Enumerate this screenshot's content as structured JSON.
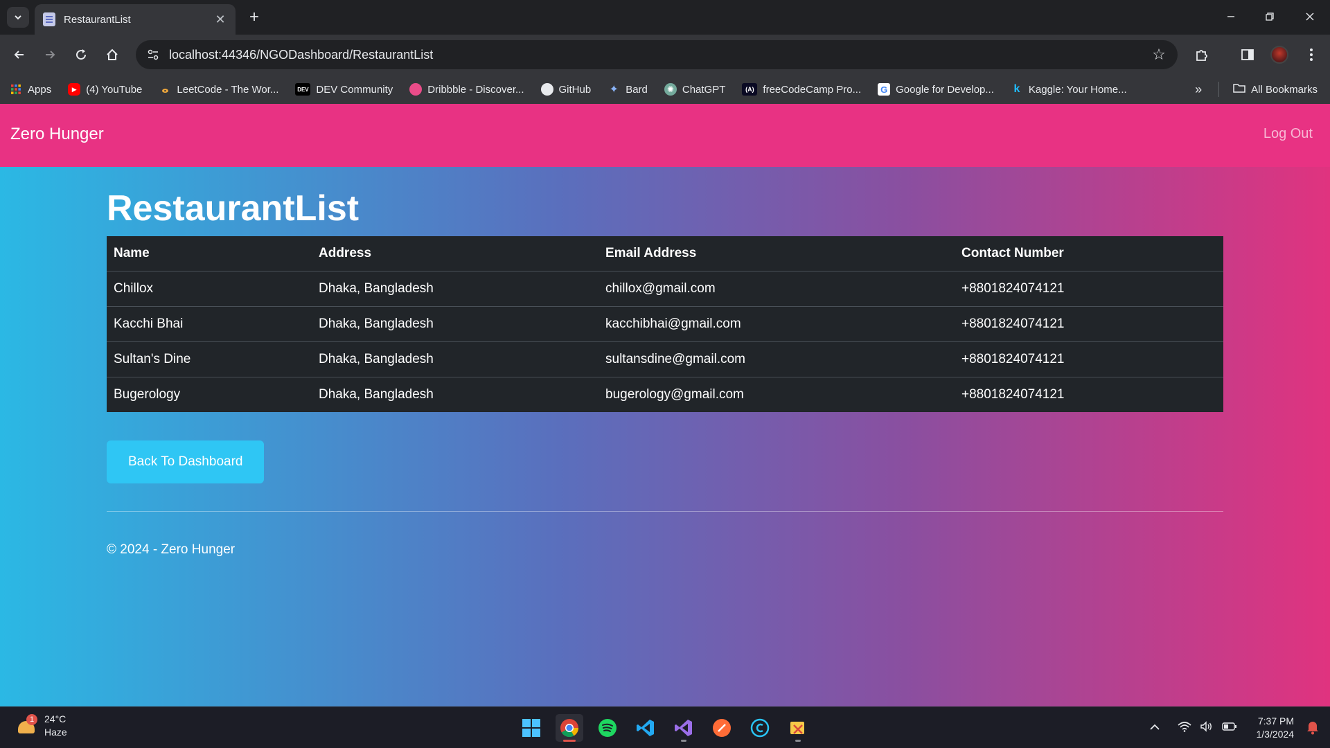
{
  "browser": {
    "tab_title": "RestaurantList",
    "url": "localhost:44346/NGODashboard/RestaurantList",
    "bookmarks": [
      {
        "label": "Apps",
        "icon": "apps-grid-icon"
      },
      {
        "label": "(4) YouTube",
        "icon": "youtube-icon"
      },
      {
        "label": "LeetCode - The Wor...",
        "icon": "leetcode-icon"
      },
      {
        "label": "DEV Community",
        "icon": "dev-icon"
      },
      {
        "label": "Dribbble - Discover...",
        "icon": "dribbble-icon"
      },
      {
        "label": "GitHub",
        "icon": "github-icon"
      },
      {
        "label": "Bard",
        "icon": "bard-icon"
      },
      {
        "label": "ChatGPT",
        "icon": "chatgpt-icon"
      },
      {
        "label": "freeCodeCamp Pro...",
        "icon": "freecodecamp-icon"
      },
      {
        "label": "Google for Develop...",
        "icon": "google-icon"
      },
      {
        "label": "Kaggle: Your Home...",
        "icon": "kaggle-icon"
      }
    ],
    "all_bookmarks": "All Bookmarks"
  },
  "navbar": {
    "brand": "Zero Hunger",
    "logout": "Log Out"
  },
  "main": {
    "title": "RestaurantList",
    "table": {
      "headers": [
        "Name",
        "Address",
        "Email Address",
        "Contact Number"
      ],
      "rows": [
        [
          "Chillox",
          "Dhaka, Bangladesh",
          "chillox@gmail.com",
          "+8801824074121"
        ],
        [
          "Kacchi Bhai",
          "Dhaka, Bangladesh",
          "kacchibhai@gmail.com",
          "+8801824074121"
        ],
        [
          "Sultan's Dine",
          "Dhaka, Bangladesh",
          "sultansdine@gmail.com",
          "+8801824074121"
        ],
        [
          "Bugerology",
          "Dhaka, Bangladesh",
          "bugerology@gmail.com",
          "+8801824074121"
        ]
      ]
    },
    "back_button": "Back To Dashboard",
    "footer": "© 2024 - Zero Hunger"
  },
  "taskbar": {
    "weather": {
      "temp": "24°C",
      "condition": "Haze",
      "badge": "1"
    },
    "time": "7:37 PM",
    "date": "1/3/2024"
  },
  "colors": {
    "navbar": "#e83283",
    "button": "#2fc6f4",
    "table_bg": "#212529"
  }
}
